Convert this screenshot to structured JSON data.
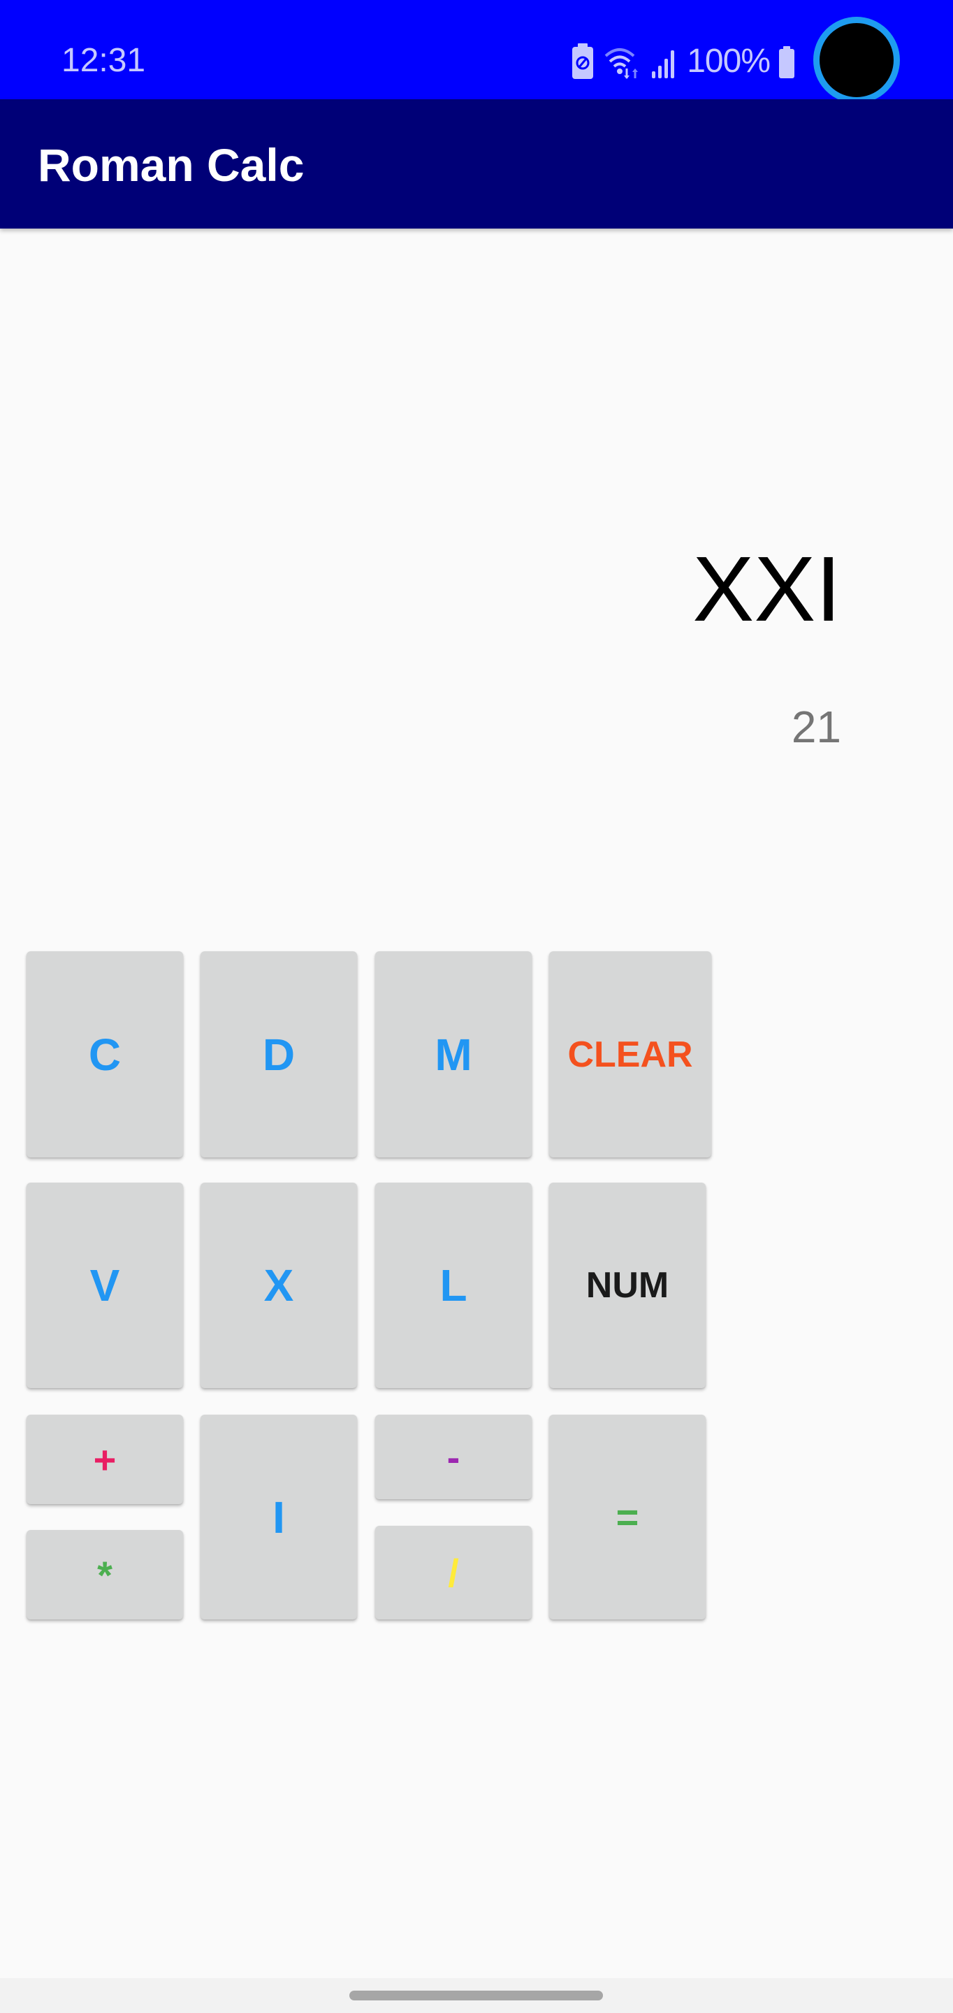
{
  "status_bar": {
    "time": "12:31",
    "battery_percent": "100%",
    "icons": [
      "battery-saver-icon",
      "wifi-icon",
      "signal-icon",
      "battery-icon"
    ],
    "background_color": "#0000ff"
  },
  "app_bar": {
    "title": "Roman Calc",
    "background_color": "#000077"
  },
  "display": {
    "roman_value": "XXI",
    "decimal_value": "21"
  },
  "keypad": {
    "buttons": {
      "c": {
        "label": "C",
        "color": "#2196f3"
      },
      "d": {
        "label": "D",
        "color": "#2196f3"
      },
      "m": {
        "label": "M",
        "color": "#2196f3"
      },
      "clear": {
        "label": "CLEAR",
        "color": "#f4511e"
      },
      "v": {
        "label": "V",
        "color": "#2196f3"
      },
      "x": {
        "label": "X",
        "color": "#2196f3"
      },
      "l": {
        "label": "L",
        "color": "#2196f3"
      },
      "num": {
        "label": "NUM",
        "color": "#1a1a1a"
      },
      "plus": {
        "label": "+",
        "color": "#e91e63"
      },
      "multiply": {
        "label": "*",
        "color": "#4caf50"
      },
      "i": {
        "label": "I",
        "color": "#2196f3"
      },
      "minus": {
        "label": "-",
        "color": "#9c27b0"
      },
      "divide": {
        "label": "/",
        "color": "#ffeb3b"
      },
      "equals": {
        "label": "=",
        "color": "#4caf50"
      }
    }
  }
}
